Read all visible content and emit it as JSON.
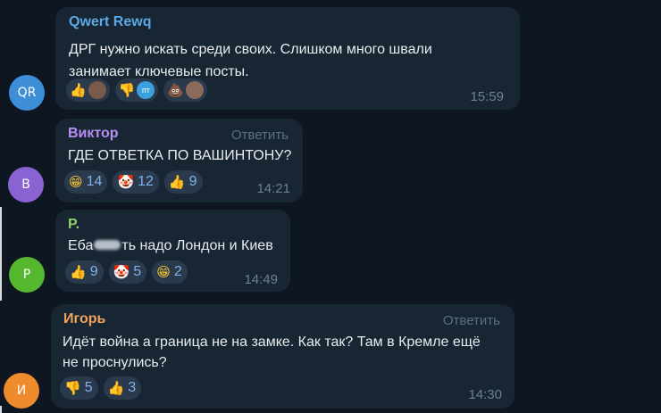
{
  "messages": [
    {
      "sender": "Qwert Rewq",
      "sender_color": "#5aa9e6",
      "avatar_initials": "QR",
      "avatar_color": "#3d8ed6",
      "lines": [
        "ДРГ нужно искать среди своих. Слишком много швали",
        "занимает ключевые посты."
      ],
      "time": "15:59",
      "reactions": [
        {
          "icon": "thumbs-up",
          "glyph": "👍"
        },
        {
          "icon": "thumbs-down",
          "glyph": "👎",
          "avatar": "пт"
        },
        {
          "icon": "poo",
          "glyph": "💩"
        }
      ]
    },
    {
      "sender": "Виктор",
      "sender_color": "#b58ef2",
      "avatar_initials": "В",
      "avatar_color": "#8a63d2",
      "reply_label": "Ответить",
      "lines": [
        "ГДЕ ОТВЕТКА ПО ВАШИНТОНУ?"
      ],
      "time": "14:21",
      "reactions": [
        {
          "icon": "grin",
          "glyph": "😁",
          "count": "14"
        },
        {
          "icon": "clown",
          "glyph": "🤡",
          "count": "12"
        },
        {
          "icon": "thumbs-up",
          "glyph": "👍",
          "count": "9"
        }
      ]
    },
    {
      "sender": "P.",
      "sender_color": "#8fd16a",
      "avatar_initials": "P",
      "avatar_color": "#56b82f",
      "text_before": "Еба",
      "text_after": "ть надо Лондон и Киев",
      "time": "14:49",
      "reactions": [
        {
          "icon": "thumbs-up",
          "glyph": "👍",
          "count": "9"
        },
        {
          "icon": "clown",
          "glyph": "🤡",
          "count": "5"
        },
        {
          "icon": "grin",
          "glyph": "😁",
          "count": "2"
        }
      ]
    },
    {
      "sender": "Игорь",
      "sender_color": "#f0a45a",
      "avatar_initials": "И",
      "avatar_color": "#ee8b2c",
      "reply_label": "Ответить",
      "lines": [
        "Идёт война а граница не на замке. Как так? Там в Кремле ещё",
        "не проснулись?"
      ],
      "time": "14:30",
      "reactions": [
        {
          "icon": "thumbs-down",
          "glyph": "👎",
          "count": "5"
        },
        {
          "icon": "thumbs-up",
          "glyph": "👍",
          "count": "3"
        }
      ]
    }
  ]
}
